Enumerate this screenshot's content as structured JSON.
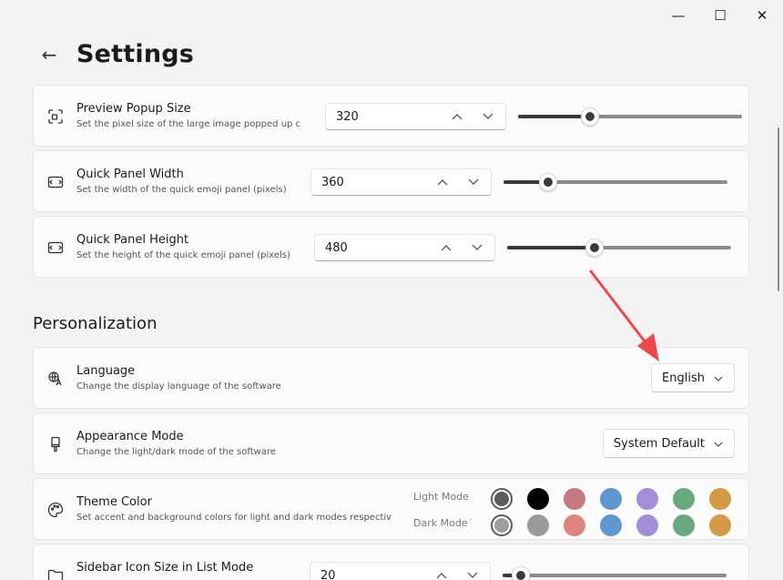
{
  "window": {
    "minimize_glyph": "—",
    "maximize_glyph": "☐",
    "close_glyph": "✕"
  },
  "header": {
    "back_glyph": "←",
    "title": "Settings"
  },
  "settings": [
    {
      "title": "Preview Popup Size",
      "desc": "Set the pixel size of the large image popped up c",
      "value": "320",
      "slider_fraction": 0.32,
      "icon": "resize-icon"
    },
    {
      "title": "Quick Panel Width",
      "desc": "Set the width of the quick emoji panel (pixels)",
      "value": "360",
      "slider_fraction": 0.2,
      "icon": "panel-width-icon"
    },
    {
      "title": "Quick Panel Height",
      "desc": "Set the height of the quick emoji panel (pixels)",
      "value": "480",
      "slider_fraction": 0.39,
      "icon": "panel-height-icon"
    }
  ],
  "personalization": {
    "section_title": "Personalization",
    "language": {
      "title": "Language",
      "desc": "Change the display language of the software",
      "value": "English",
      "icon": "language-icon"
    },
    "appearance": {
      "title": "Appearance Mode",
      "desc": "Change the light/dark mode of the software",
      "value": "System Default",
      "icon": "brush-icon"
    },
    "theme": {
      "title": "Theme Color",
      "desc": "Set accent and background colors for light and dark modes respectiv",
      "light_label": "Light Mode T",
      "dark_label": "Dark Mode T",
      "light_colors": [
        "#5c5c5c",
        "#000000",
        "#c4787f",
        "#5e96cf",
        "#a28fd8",
        "#6aa97f",
        "#d29a44"
      ],
      "dark_colors": [
        "#9e9e9e",
        "#9a9a9a",
        "#dd857c",
        "#5e96cf",
        "#a28fd8",
        "#6aa97f",
        "#d29a44"
      ],
      "icon": "palette-icon"
    },
    "sidebar_icon": {
      "title": "Sidebar Icon Size in List Mode",
      "value": "20",
      "slider_fraction": 0.08,
      "icon": "folder-icon"
    }
  },
  "colors": {
    "annotation_arrow": "#f04848"
  }
}
